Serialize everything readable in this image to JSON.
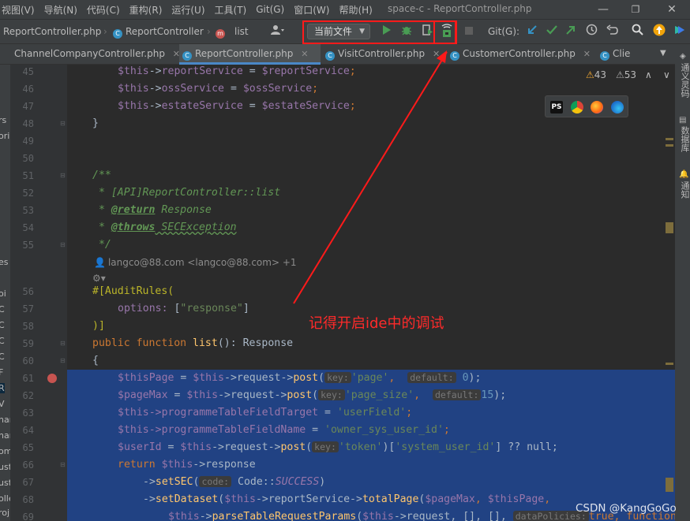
{
  "window": {
    "title": "space-c - ReportController.php",
    "minimize": "—",
    "maximize": "❐",
    "close": "✕"
  },
  "menu": [
    "视图(V)",
    "导航(N)",
    "代码(C)",
    "重构(R)",
    "运行(U)",
    "工具(T)",
    "Git(G)",
    "窗口(W)",
    "帮助(H)"
  ],
  "breadcrumb": {
    "file": "ReportController.php",
    "class": "ReportController",
    "method": "list",
    "class_icon": "C",
    "method_icon": "m"
  },
  "toolbar": {
    "run_config": "当前文件",
    "git_label": "Git(G):"
  },
  "tabs": [
    {
      "label": "ChannelCompanyController.php",
      "active": false
    },
    {
      "label": "ReportController.php",
      "active": true
    },
    {
      "label": "VisitController.php",
      "active": false
    },
    {
      "label": "CustomerController.php",
      "active": false
    },
    {
      "label": "Clie",
      "active": false
    }
  ],
  "inspections": {
    "warnings": "43",
    "weak_warnings": "53"
  },
  "right_panels": [
    "通义灵码",
    "数据库",
    "通知"
  ],
  "left_strip": [
    "rs",
    "ori",
    "es",
    "oi",
    "C",
    "C",
    "C",
    "C",
    "F",
    "R",
    "V",
    "han",
    "han",
    "om",
    "ust",
    "ust",
    "olle",
    "roj",
    "oj"
  ],
  "line_numbers": [
    "45",
    "46",
    "47",
    "48",
    "49",
    "50",
    "51",
    "52",
    "53",
    "54",
    "55",
    "56",
    "57",
    "58",
    "59",
    "60",
    "61",
    "62",
    "63",
    "64",
    "65",
    "66",
    "67",
    "68",
    "69"
  ],
  "code": {
    "l45": {
      "a": "$this",
      "b": "->",
      "c": "reportService",
      "d": " = ",
      "e": "$reportService",
      "f": ";"
    },
    "l46": {
      "a": "$this",
      "b": "->",
      "c": "ossService",
      "d": " = ",
      "e": "$ossService",
      "f": ";"
    },
    "l47": {
      "a": "$this",
      "b": "->",
      "c": "estateService",
      "d": " = ",
      "e": "$estateService",
      "f": ";"
    },
    "l48": "}",
    "l51": "/**",
    "l52": " * [API]ReportController::list",
    "l53_star": " * ",
    "l53_tag": "@return",
    "l53_text": " Response",
    "l54_star": " * ",
    "l54_tag": "@throws",
    "l54_text": " SECException",
    "l55": " */",
    "author": "langco@88.com <langco@88.com> +1",
    "l56a": "#[AuditRules(",
    "l57a": "options: ",
    "l57b": "[",
    "l57c": "\"response\"",
    "l57d": "]",
    "l58": ")]",
    "l59_kw1": "public ",
    "l59_kw2": "function ",
    "l59_fn": "list",
    "l59_rest": "(): Response",
    "l60": "{",
    "l61_var": "$thisPage",
    "l61_eq": " = ",
    "l61_this": "$this",
    "l61_mid": "->request->",
    "l61_fn": "post",
    "l61_hint1": "key:",
    "l61_str": "'page'",
    "l61_comma": ",  ",
    "l61_hint2": "default:",
    "l61_num": "0",
    "l61_end": ");",
    "l62_var": "$pageMax",
    "l62_eq": " = ",
    "l62_this": "$this",
    "l62_mid": "->request->",
    "l62_fn": "post",
    "l62_hint1": "key:",
    "l62_str": "'page_size'",
    "l62_comma": ",  ",
    "l62_hint2": "default:",
    "l62_num": "15",
    "l62_end": ");",
    "l63_this": "$this",
    "l63_mid": "->programmeTableFieldTarget",
    "l63_eq": " = ",
    "l63_str": "'userField'",
    "l63_end": ";",
    "l64_this": "$this",
    "l64_mid": "->programmeTableFieldName",
    "l64_eq": " = ",
    "l64_str": "'owner_sys_user_id'",
    "l64_end": ";",
    "l65_var": "$userId",
    "l65_eq": " = ",
    "l65_this": "$this",
    "l65_mid": "->request->",
    "l65_fn": "post",
    "l65_hint": "key:",
    "l65_str": "'token'",
    "l65_idx1": ")[",
    "l65_str2": "'system_user_id'",
    "l65_end": "] ?? null;",
    "l66_kw": "return ",
    "l66_this": "$this",
    "l66_rest": "->response",
    "l67_a": "->",
    "l67_fn": "setSEC",
    "l67_b": "(",
    "l67_hint": "code:",
    "l67_c": " Code::",
    "l67_const": "SUCCESS",
    "l67_d": ")",
    "l68_a": "->",
    "l68_fn": "setDataset",
    "l68_b": "(",
    "l68_this": "$this",
    "l68_c": "->reportService->",
    "l68_fn2": "totalPage",
    "l68_d": "(",
    "l68_v1": "$pageMax",
    "l68_e": ", ",
    "l68_v2": "$thisPage",
    "l68_f": ",",
    "l69_this": "$this",
    "l69_a": "->",
    "l69_fn": "parseTableRequestParams",
    "l69_b": "(",
    "l69_this2": "$this",
    "l69_c": "->request, [], [],",
    "l69_hint": "dataPolicies:",
    "l69_kw": "true",
    "l69_d": ", ",
    "l69_kw2": "function"
  },
  "annotation": "记得开启ide中的调试",
  "watermark": "CSDN @KangGoGo",
  "colors": {
    "annotation": "#ff2a2a",
    "selection": "#214283",
    "active_tab_underline": "#4a88c7"
  }
}
